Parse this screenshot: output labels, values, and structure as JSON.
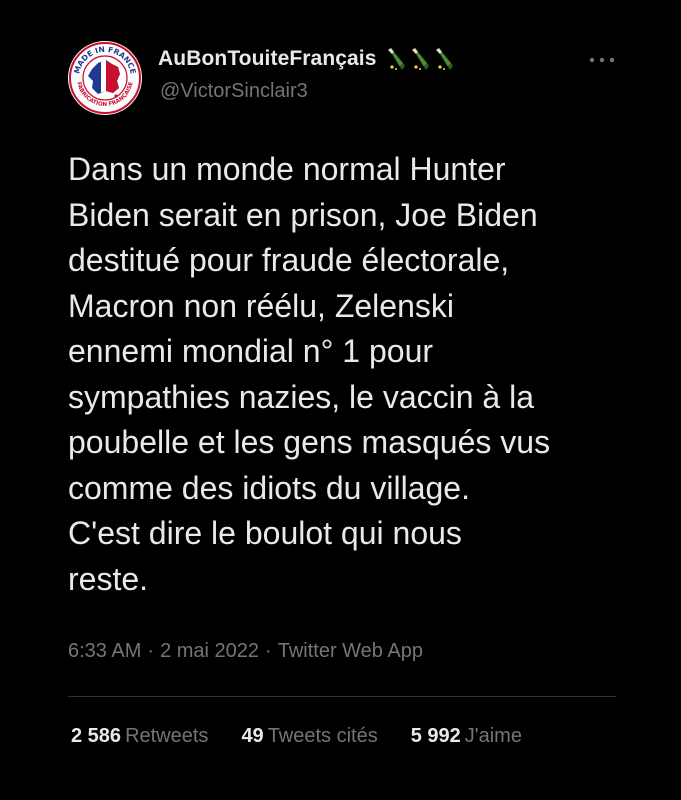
{
  "tweet": {
    "display_name": "AuBonTouiteFrançais",
    "handle": "@VictorSinclair3",
    "name_emojis": [
      "bottle-icon",
      "bottle-icon",
      "bottle-icon"
    ],
    "avatar": {
      "text_top": "MADE IN FRANCE",
      "text_bottom": "FABRICATION FRANÇAISE"
    },
    "text": "Dans un monde normal Hunter\nBiden serait en prison, Joe Biden\ndestitué pour fraude électorale,\nMacron non réélu, Zelenski\nennemi mondial n° 1 pour\nsympathies nazies, le vaccin à la\npoubelle et les gens masqués vus\ncomme des idiots du village.\nC'est dire le boulot qui nous\nreste.",
    "time": "6:33 AM",
    "separator": "·",
    "date": "2 mai 2022",
    "source": "Twitter Web App"
  },
  "stats": {
    "retweets": {
      "value": "2 586",
      "label": "Retweets"
    },
    "quotes": {
      "value": "49",
      "label": "Tweets cités"
    },
    "likes": {
      "value": "5 992",
      "label": "J'aime"
    }
  },
  "colors": {
    "background": "#000000",
    "primary_text": "#e7e9ea",
    "secondary_text": "#71767b",
    "divider": "#2f3336",
    "avatar_border": "#c8102e",
    "avatar_blue": "#1f3a93"
  }
}
